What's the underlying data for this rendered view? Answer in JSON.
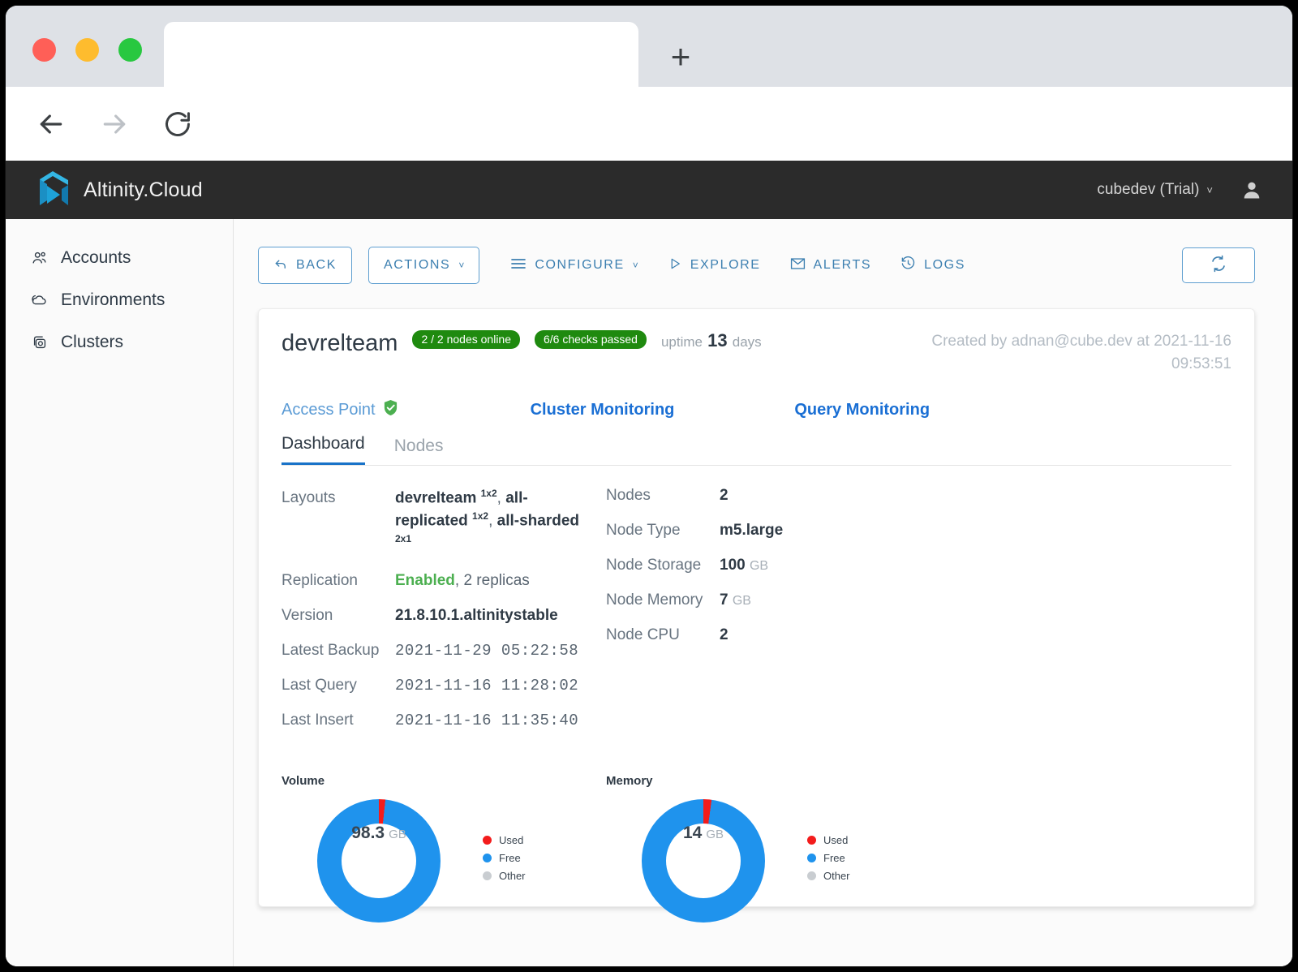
{
  "browser": {
    "tab_title": "",
    "url_value": "",
    "url_placeholder": "",
    "new_tab_label": "+",
    "back_icon": "arrow-left-icon",
    "forward_icon": "arrow-right-icon",
    "reload_icon": "reload-icon",
    "menu_icon": "kebab-menu-icon"
  },
  "header": {
    "brand": "Altinity.Cloud",
    "logo_icon": "altinity-logo-icon",
    "account": "cubedev (Trial)",
    "account_chevron": "˅",
    "avatar_icon": "user-avatar-icon"
  },
  "sidebar": {
    "items": [
      {
        "label": "Accounts",
        "icon": "accounts-icon"
      },
      {
        "label": "Environments",
        "icon": "environments-icon"
      },
      {
        "label": "Clusters",
        "icon": "clusters-icon"
      }
    ]
  },
  "toolbar": {
    "back": "BACK",
    "actions": "ACTIONS",
    "configure": "CONFIGURE",
    "explore": "EXPLORE",
    "alerts": "ALERTS",
    "logs": "LOGS",
    "caret": "˅",
    "refresh_icon": "refresh-icon"
  },
  "cluster": {
    "name": "devrelteam",
    "nodes_pill": "2 / 2 nodes online",
    "checks_pill": "6/6 checks passed",
    "uptime_label": "uptime",
    "uptime_value": "13",
    "uptime_unit": "days",
    "created": "Created by adnan@cube.dev at 2021-11-16 09:53:51"
  },
  "monitoring": {
    "access_point": "Access Point",
    "access_point_icon": "shield-check-icon",
    "cluster_monitoring": "Cluster Monitoring",
    "query_monitoring": "Query Monitoring"
  },
  "tabs": [
    {
      "label": "Dashboard",
      "active": true
    },
    {
      "label": "Nodes",
      "active": false
    }
  ],
  "details_left": [
    {
      "label": "Layouts",
      "parts": [
        {
          "t": "devrelteam ",
          "b": true
        },
        {
          "t": "1x2",
          "sup": true
        },
        {
          "t": ", ",
          "b": false
        },
        {
          "t": "all-replicated ",
          "b": true
        },
        {
          "t": "1x2",
          "sup": true
        },
        {
          "t": ", ",
          "b": false
        },
        {
          "t": "all-sharded ",
          "b": true
        },
        {
          "t": "2x1",
          "sup": true
        }
      ],
      "plain": "devrelteam 1x2, all-replicated 1x2, all-sharded 2x1"
    },
    {
      "label": "Replication",
      "value": "Enabled, 2 replicas",
      "enabled_prefix": "Enabled",
      "rest": ", 2 replicas"
    },
    {
      "label": "Version",
      "value": "21.8.10.1.altinitystable"
    },
    {
      "label": "Latest Backup",
      "value": "2021-11-29 05:22:58",
      "mono": true
    },
    {
      "label": "Last Query",
      "value": "2021-11-16 11:28:02",
      "mono": true
    },
    {
      "label": "Last Insert",
      "value": "2021-11-16 11:35:40",
      "mono": true
    }
  ],
  "details_right": [
    {
      "label": "Nodes",
      "value": "2",
      "unit": ""
    },
    {
      "label": "Node Type",
      "value": "m5.large",
      "unit": ""
    },
    {
      "label": "Node Storage",
      "value": "100",
      "unit": "GB"
    },
    {
      "label": "Node Memory",
      "value": "7",
      "unit": "GB"
    },
    {
      "label": "Node CPU",
      "value": "2",
      "unit": ""
    }
  ],
  "chart_data": [
    {
      "type": "pie",
      "title": "Volume",
      "labels": [
        "Used",
        "Free",
        "Other"
      ],
      "values": [
        1.7,
        98.3,
        0
      ],
      "colors": [
        "#f31c1c",
        "#1f93ed",
        "#c9cdd1"
      ],
      "center_value": "98.3",
      "center_unit": "GB",
      "legend_position": "right"
    },
    {
      "type": "pie",
      "title": "Memory",
      "labels": [
        "Used",
        "Free",
        "Other"
      ],
      "values": [
        0.3,
        13.7,
        0
      ],
      "colors": [
        "#f31c1c",
        "#1f93ed",
        "#c9cdd1"
      ],
      "center_value": "14",
      "center_unit": "GB",
      "legend_position": "right"
    }
  ]
}
